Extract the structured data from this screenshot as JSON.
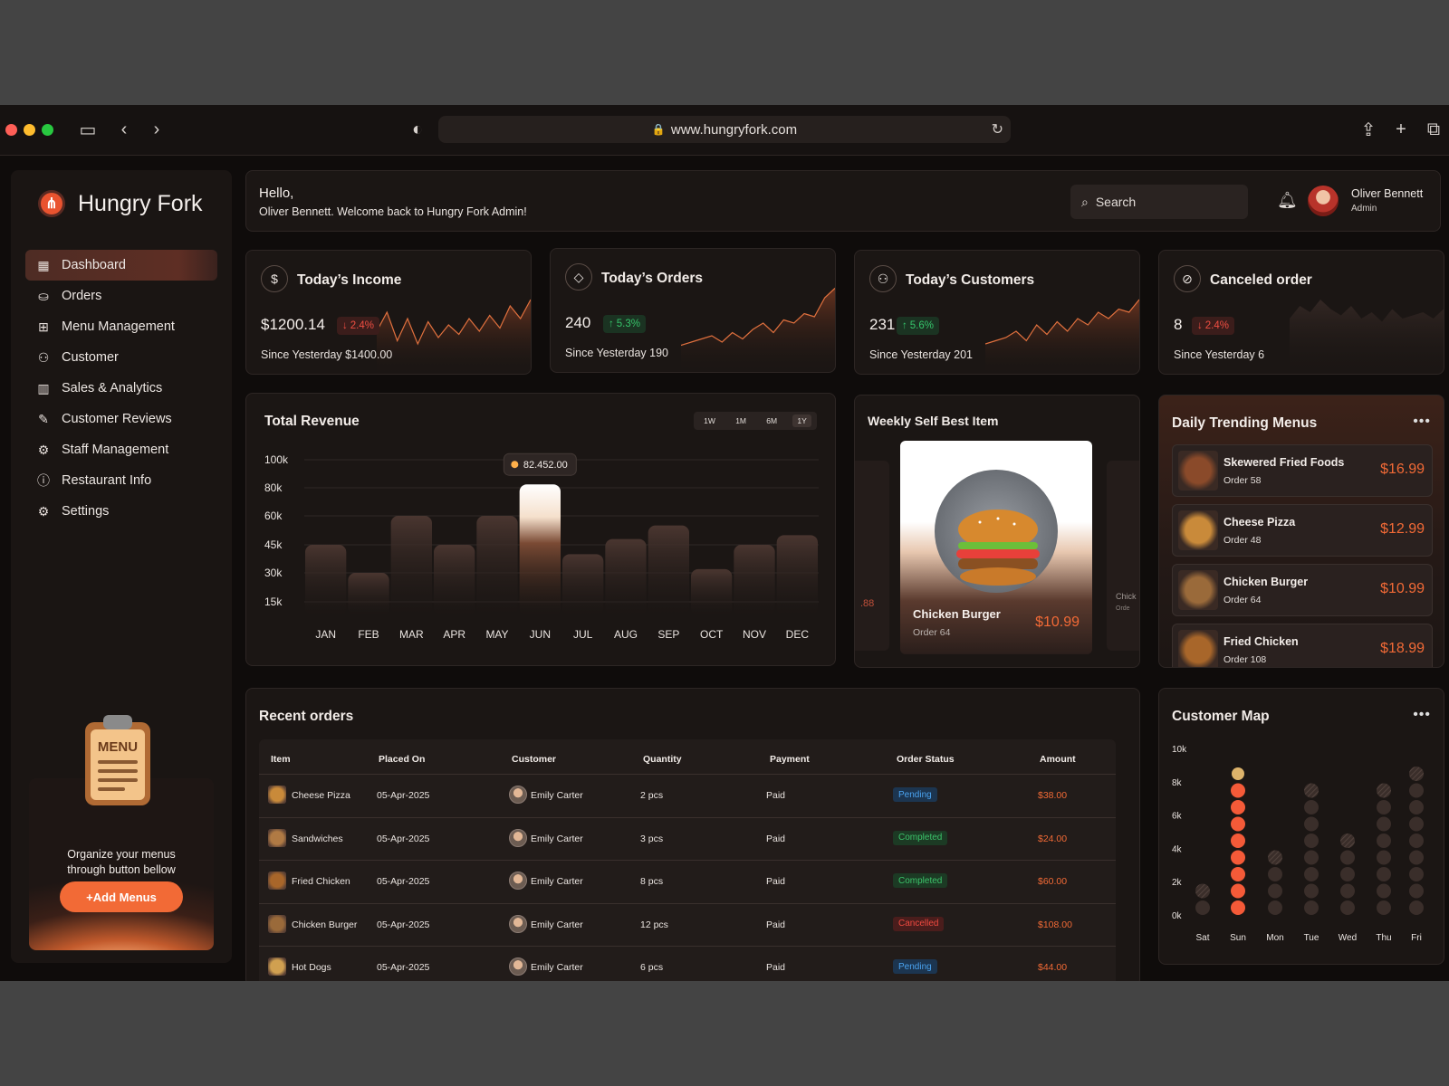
{
  "browser": {
    "url": "www.hungryfork.com",
    "traffic_lights": [
      "#fe5f57",
      "#febc2e",
      "#28c840"
    ]
  },
  "brand": {
    "name": "Hungry Fork",
    "accent": "#f26a36"
  },
  "sidebar": {
    "items": [
      {
        "label": "Dashboard",
        "icon": "dashboard-icon",
        "glyph": "▦",
        "active": true
      },
      {
        "label": "Orders",
        "icon": "basket-icon",
        "glyph": "⛀",
        "active": false
      },
      {
        "label": "Menu Management",
        "icon": "grid-icon",
        "glyph": "⊞",
        "active": false
      },
      {
        "label": "Customer",
        "icon": "users-icon",
        "glyph": "⚇",
        "active": false
      },
      {
        "label": "Sales & Analytics",
        "icon": "bar-chart-icon",
        "glyph": "▥",
        "active": false
      },
      {
        "label": "Customer Reviews",
        "icon": "edit-icon",
        "glyph": "✎",
        "active": false
      },
      {
        "label": "Staff Management",
        "icon": "staff-icon",
        "glyph": "⚙",
        "active": false
      },
      {
        "label": "Restaurant Info",
        "icon": "info-icon",
        "glyph": "ⓘ",
        "active": false
      },
      {
        "label": "Settings",
        "icon": "settings-icon",
        "glyph": "⚙",
        "active": false
      }
    ],
    "promo_text_1": "Organize your menus",
    "promo_text_2": "through button bellow",
    "promo_button": "+Add Menus",
    "clipboard_text": "MENU"
  },
  "header": {
    "greeting": "Hello,",
    "welcome": "Oliver Bennett. Welcome back to Hungry Fork Admin!",
    "search_placeholder": "Search",
    "user_name": "Oliver Bennett",
    "user_role": "Admin"
  },
  "stats": [
    {
      "title": "Today’s Income",
      "value": "$1200.14",
      "change": "2.4%",
      "direction": "down",
      "since": "Since Yesterday $1400.00",
      "icon": "money-bag-icon"
    },
    {
      "title": "Today’s Orders",
      "value": "240",
      "change": "5.3%",
      "direction": "up",
      "since": "Since Yesterday 190",
      "icon": "shopping-bag-icon"
    },
    {
      "title": "Today’s Customers",
      "value": "231",
      "change": "5.6%",
      "direction": "up",
      "since": "Since Yesterday 201",
      "icon": "customers-icon"
    },
    {
      "title": "Canceled order",
      "value": "8",
      "change": "2.4%",
      "direction": "down",
      "since": "Since Yesterday 6",
      "icon": "cancel-order-icon"
    }
  ],
  "revenue": {
    "title": "Total Revenue",
    "timeframes": [
      "1W",
      "1M",
      "6M",
      "1Y"
    ],
    "selected_timeframe": "1Y",
    "tooltip": "82.452.00"
  },
  "chart_data": {
    "type": "bar",
    "title": "Total Revenue",
    "categories": [
      "JAN",
      "FEB",
      "MAR",
      "APR",
      "MAY",
      "JUN",
      "JUL",
      "AUG",
      "SEP",
      "OCT",
      "NOV",
      "DEC"
    ],
    "values": [
      45000,
      30000,
      60000,
      45000,
      60000,
      82452,
      40000,
      48000,
      55000,
      32000,
      45000,
      50000
    ],
    "yticks": [
      "100k",
      "80k",
      "60k",
      "45k",
      "30k",
      "15k"
    ],
    "ytick_values": [
      100000,
      80000,
      60000,
      45000,
      30000,
      15000
    ],
    "ylim": [
      15000,
      100000
    ],
    "highlight_index": 5,
    "grid": true
  },
  "weekly_best": {
    "title": "Weekly Self Best Item",
    "name": "Chicken Burger",
    "order": "Order 64",
    "price": "$10.99",
    "left_peek_price": ".88",
    "right_peek_name": "Chick",
    "right_peek_order": "Orde"
  },
  "trending": {
    "title": "Daily Trending Menus",
    "items": [
      {
        "name": "Skewered Fried Foods",
        "order": "Order 58",
        "price": "$16.99",
        "color": "#8a4a2a"
      },
      {
        "name": "Cheese Pizza",
        "order": "Order 48",
        "price": "$12.99",
        "color": "#c98a3a"
      },
      {
        "name": "Chicken Burger",
        "order": "Order 64",
        "price": "$10.99",
        "color": "#9a6a3a"
      },
      {
        "name": "Fried Chicken",
        "order": "Order 108",
        "price": "$18.99",
        "color": "#a8662a"
      }
    ]
  },
  "orders": {
    "title": "Recent orders",
    "columns": [
      "Item",
      "Placed On",
      "Customer",
      "Quantity",
      "Payment",
      "Order Status",
      "Amount"
    ],
    "rows": [
      {
        "item": "Cheese Pizza",
        "placed": "05-Apr-2025",
        "customer": "Emily Carter",
        "qty": "2 pcs",
        "payment": "Paid",
        "status": "Pending",
        "amount": "$38.00",
        "thumb": "#c98a3a"
      },
      {
        "item": "Sandwiches",
        "placed": "05-Apr-2025",
        "customer": "Emily Carter",
        "qty": "3 pcs",
        "payment": "Paid",
        "status": "Completed",
        "amount": "$24.00",
        "thumb": "#b07a44"
      },
      {
        "item": "Fried Chicken",
        "placed": "05-Apr-2025",
        "customer": "Emily Carter",
        "qty": "8 pcs",
        "payment": "Paid",
        "status": "Completed",
        "amount": "$60.00",
        "thumb": "#a8662a"
      },
      {
        "item": "Chicken Burger",
        "placed": "05-Apr-2025",
        "customer": "Emily Carter",
        "qty": "12 pcs",
        "payment": "Paid",
        "status": "Cancelled",
        "amount": "$108.00",
        "thumb": "#9a6a3a"
      },
      {
        "item": "Hot Dogs",
        "placed": "05-Apr-2025",
        "customer": "Emily Carter",
        "qty": "6 pcs",
        "payment": "Paid",
        "status": "Pending",
        "amount": "$44.00",
        "thumb": "#d0a050"
      }
    ],
    "status_colors": {
      "Pending": {
        "bg": "#1c3550",
        "fg": "#4aa3f0"
      },
      "Completed": {
        "bg": "#1c3a24",
        "fg": "#3cc36a"
      },
      "Cancelled": {
        "bg": "#4a1d1c",
        "fg": "#f04a40"
      }
    }
  },
  "customer_map": {
    "title": "Customer Map",
    "type": "dot-column",
    "yticks": [
      "10k",
      "8k",
      "6k",
      "4k",
      "2k",
      "0k"
    ],
    "days": [
      "Sat",
      "Sun",
      "Mon",
      "Tue",
      "Wed",
      "Thu",
      "Fri"
    ],
    "values_k": [
      2,
      8,
      4,
      8,
      4.5,
      7.5,
      9
    ],
    "highlight_day": "Sun"
  }
}
